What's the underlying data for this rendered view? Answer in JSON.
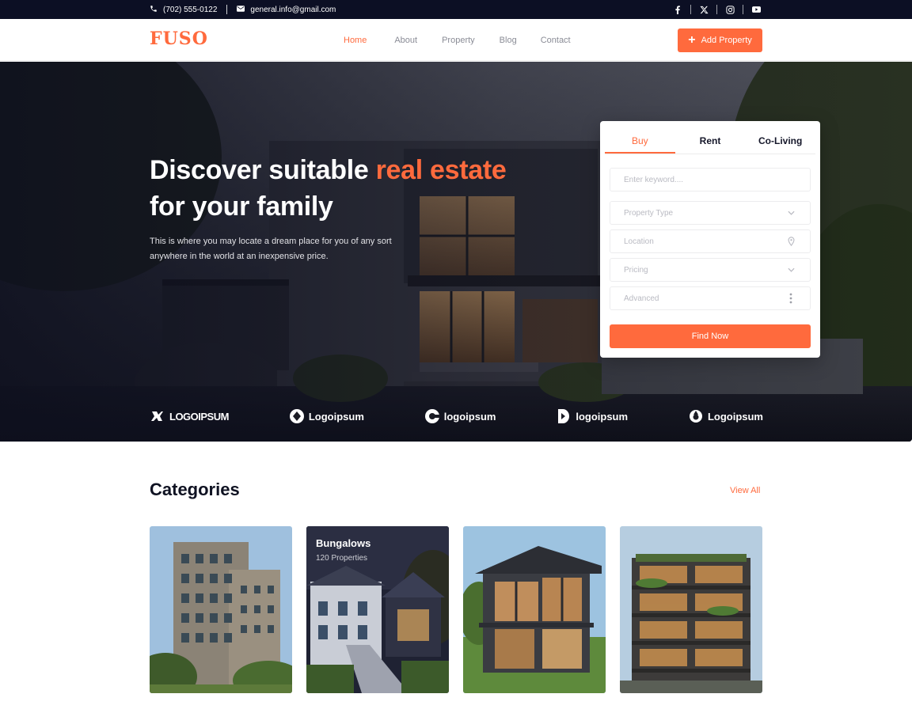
{
  "topbar": {
    "phone": "(702) 555-0122",
    "email": "general.info@gmail.com",
    "social": [
      "facebook-icon",
      "x-icon",
      "instagram-icon",
      "youtube-icon"
    ]
  },
  "nav": {
    "logo": "FUSO",
    "menu": [
      {
        "label": "Home",
        "active": true
      },
      {
        "label": "About",
        "active": false
      },
      {
        "label": "Property",
        "active": false
      },
      {
        "label": "Blog",
        "active": false
      },
      {
        "label": "Contact",
        "active": false
      }
    ],
    "cta": "Add Property"
  },
  "hero": {
    "title_part1": "Discover suitable ",
    "title_accent": "real estate",
    "title_part2": "for your family",
    "subtitle": "This is where you may locate a dream place for you of any sort anywhere in the world at an inexpensive price."
  },
  "search": {
    "tabs": [
      {
        "label": "Buy",
        "active": true
      },
      {
        "label": "Rent",
        "active": false
      },
      {
        "label": "Co-Living",
        "active": false
      }
    ],
    "keyword_placeholder": "Enter keyword....",
    "property_type_placeholder": "Property Type",
    "location_placeholder": "Location",
    "pricing_placeholder": "Pricing",
    "advanced_placeholder": "Advanced",
    "submit": "Find Now"
  },
  "partners": [
    "LOGOIPSUM",
    "Logoipsum",
    "logoipsum",
    "logoipsum",
    "Logoipsum"
  ],
  "categories": {
    "title": "Categories",
    "view_all": "View All",
    "items": [
      {
        "name": "",
        "count": ""
      },
      {
        "name": "Bungalows",
        "count": "120 Properties"
      },
      {
        "name": "",
        "count": ""
      },
      {
        "name": "",
        "count": ""
      }
    ]
  },
  "colors": {
    "accent": "#ff6a3d",
    "topbar": "#0c0f24",
    "heading": "#0f1222"
  }
}
